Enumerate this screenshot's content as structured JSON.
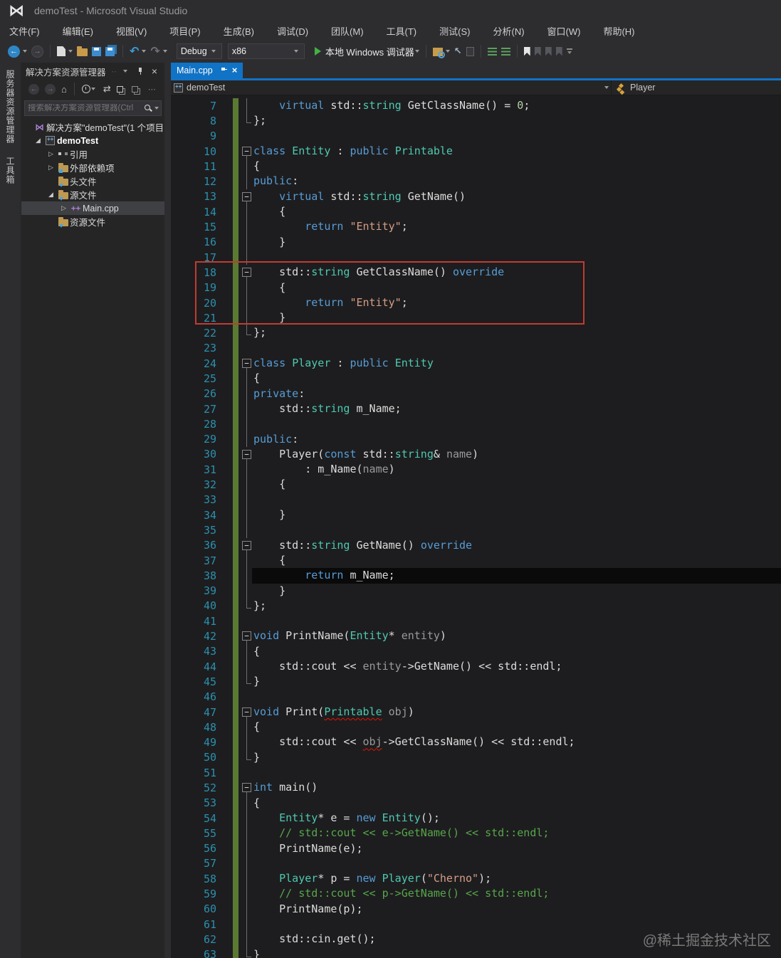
{
  "title_bar": {
    "app_title": "demoTest - Microsoft Visual Studio"
  },
  "menu_bar": {
    "items": [
      "文件(F)",
      "编辑(E)",
      "视图(V)",
      "项目(P)",
      "生成(B)",
      "调试(D)",
      "团队(M)",
      "工具(T)",
      "测试(S)",
      "分析(N)",
      "窗口(W)",
      "帮助(H)"
    ]
  },
  "toolbar": {
    "left_icons": [
      "navigate-back",
      "navigate-forward",
      "separator",
      "new-file",
      "open-file",
      "save",
      "save-all",
      "separator",
      "undo",
      "redo"
    ],
    "configuration": "Debug",
    "platform": "x86",
    "start_label": "本地 Windows 调试器",
    "right_icons": [
      "separator",
      "find-in-files",
      "navigate-to",
      "paste",
      "separator",
      "comment-selection",
      "uncomment-selection",
      "separator",
      "toggle-bookmark",
      "previous-bookmark",
      "next-bookmark",
      "clear-bookmarks",
      "overflow"
    ]
  },
  "side_strip": {
    "tabs": [
      "服务器资源管理器",
      "工具箱"
    ]
  },
  "solution_explorer": {
    "title": "解决方案资源管理器",
    "toolbar_icons": [
      "back",
      "forward",
      "home",
      "separator",
      "changes-filter",
      "sync-active-document",
      "collapse-all",
      "properties",
      "overflow-dots"
    ],
    "search_placeholder": "搜索解决方案资源管理器(Ctrl",
    "tree": [
      {
        "id": "solution",
        "label": "解决方案\"demoTest\"(1 个项目",
        "icon": "solution",
        "twisty": "",
        "depth": 0,
        "bold": false,
        "selected": false
      },
      {
        "id": "project-demotest",
        "label": "demoTest",
        "icon": "vcxproj",
        "twisty": "expanded",
        "depth": 1,
        "bold": true,
        "selected": false
      },
      {
        "id": "references",
        "label": "引用",
        "icon": "references",
        "twisty": "collapsed",
        "depth": 2,
        "bold": false,
        "selected": false
      },
      {
        "id": "external-dependencies",
        "label": "外部依赖项",
        "icon": "dep-folder",
        "twisty": "collapsed",
        "depth": 2,
        "bold": false,
        "selected": false
      },
      {
        "id": "header-files",
        "label": "头文件",
        "icon": "filter-folder",
        "twisty": "",
        "depth": 2,
        "bold": false,
        "selected": false
      },
      {
        "id": "source-files",
        "label": "源文件",
        "icon": "filter-folder",
        "twisty": "expanded",
        "depth": 2,
        "bold": false,
        "selected": false
      },
      {
        "id": "main-cpp",
        "label": "Main.cpp",
        "icon": "cpp-file",
        "twisty": "collapsed",
        "depth": 3,
        "bold": false,
        "selected": true
      },
      {
        "id": "resource-files",
        "label": "资源文件",
        "icon": "filter-folder",
        "twisty": "",
        "depth": 2,
        "bold": false,
        "selected": false
      }
    ]
  },
  "editor": {
    "tab_label": "Main.cpp",
    "breadcrumb": {
      "project": "demoTest",
      "member": "Player"
    },
    "code": {
      "current_line": 38,
      "lines": [
        {
          "n": 7,
          "g": "line",
          "tk": [
            [
              "    ",
              "pl"
            ],
            [
              "virtual",
              "kw"
            ],
            [
              " std::",
              "pl"
            ],
            [
              "string",
              "ty"
            ],
            [
              " GetClassName() = ",
              "pl"
            ],
            [
              "0",
              "nm"
            ],
            [
              ";",
              "pl"
            ]
          ]
        },
        {
          "n": 8,
          "g": "end",
          "tk": [
            [
              "};",
              "pl"
            ]
          ]
        },
        {
          "n": 9,
          "g": "",
          "tk": []
        },
        {
          "n": 10,
          "g": "box",
          "tk": [
            [
              "class",
              "kw"
            ],
            [
              " ",
              "pl"
            ],
            [
              "Entity",
              "ty"
            ],
            [
              " : ",
              "pl"
            ],
            [
              "public",
              "kw"
            ],
            [
              " ",
              "pl"
            ],
            [
              "Printable",
              "ty"
            ]
          ]
        },
        {
          "n": 11,
          "g": "line",
          "tk": [
            [
              "{",
              "pl"
            ]
          ]
        },
        {
          "n": 12,
          "g": "line",
          "tk": [
            [
              "public",
              "kw"
            ],
            [
              ":",
              "pl"
            ]
          ]
        },
        {
          "n": 13,
          "g": "box",
          "tk": [
            [
              "    ",
              "pl"
            ],
            [
              "virtual",
              "kw"
            ],
            [
              " std::",
              "pl"
            ],
            [
              "string",
              "ty"
            ],
            [
              " GetName()",
              "pl"
            ]
          ]
        },
        {
          "n": 14,
          "g": "line",
          "tk": [
            [
              "    {",
              "pl"
            ]
          ]
        },
        {
          "n": 15,
          "g": "line",
          "tk": [
            [
              "        ",
              "pl"
            ],
            [
              "return",
              "kw"
            ],
            [
              " ",
              "pl"
            ],
            [
              "\"Entity\"",
              "st"
            ],
            [
              ";",
              "pl"
            ]
          ]
        },
        {
          "n": 16,
          "g": "line",
          "tk": [
            [
              "    }",
              "pl"
            ]
          ]
        },
        {
          "n": 17,
          "g": "line",
          "tk": []
        },
        {
          "n": 18,
          "g": "box",
          "tk": [
            [
              "    std::",
              "pl"
            ],
            [
              "string",
              "ty"
            ],
            [
              " GetClassName() ",
              "pl"
            ],
            [
              "override",
              "kw"
            ]
          ]
        },
        {
          "n": 19,
          "g": "line",
          "tk": [
            [
              "    {",
              "pl"
            ]
          ]
        },
        {
          "n": 20,
          "g": "line",
          "tk": [
            [
              "        ",
              "pl"
            ],
            [
              "return",
              "kw"
            ],
            [
              " ",
              "pl"
            ],
            [
              "\"Entity\"",
              "st"
            ],
            [
              ";",
              "pl"
            ]
          ]
        },
        {
          "n": 21,
          "g": "line",
          "tk": [
            [
              "    }",
              "pl"
            ]
          ]
        },
        {
          "n": 22,
          "g": "end",
          "tk": [
            [
              "};",
              "pl"
            ]
          ]
        },
        {
          "n": 23,
          "g": "",
          "tk": []
        },
        {
          "n": 24,
          "g": "box",
          "tk": [
            [
              "class",
              "kw"
            ],
            [
              " ",
              "pl"
            ],
            [
              "Player",
              "ty"
            ],
            [
              " : ",
              "pl"
            ],
            [
              "public",
              "kw"
            ],
            [
              " ",
              "pl"
            ],
            [
              "Entity",
              "ty"
            ]
          ]
        },
        {
          "n": 25,
          "g": "line",
          "tk": [
            [
              "{",
              "pl"
            ]
          ]
        },
        {
          "n": 26,
          "g": "line",
          "tk": [
            [
              "private",
              "kw"
            ],
            [
              ":",
              "pl"
            ]
          ]
        },
        {
          "n": 27,
          "g": "line",
          "tk": [
            [
              "    std::",
              "pl"
            ],
            [
              "string",
              "ty"
            ],
            [
              " m_Name;",
              "pl"
            ]
          ]
        },
        {
          "n": 28,
          "g": "line",
          "tk": []
        },
        {
          "n": 29,
          "g": "line",
          "tk": [
            [
              "public",
              "kw"
            ],
            [
              ":",
              "pl"
            ]
          ]
        },
        {
          "n": 30,
          "g": "box",
          "tk": [
            [
              "    Player(",
              "pl"
            ],
            [
              "const",
              "kw"
            ],
            [
              " std::",
              "pl"
            ],
            [
              "string",
              "ty"
            ],
            [
              "& ",
              "pl"
            ],
            [
              "name",
              "pr"
            ],
            [
              ")",
              "pl"
            ]
          ]
        },
        {
          "n": 31,
          "g": "line",
          "tk": [
            [
              "        : m_Name(",
              "pl"
            ],
            [
              "name",
              "pr"
            ],
            [
              ")",
              "pl"
            ]
          ]
        },
        {
          "n": 32,
          "g": "line",
          "tk": [
            [
              "    {",
              "pl"
            ]
          ]
        },
        {
          "n": 33,
          "g": "line",
          "tk": []
        },
        {
          "n": 34,
          "g": "line",
          "tk": [
            [
              "    }",
              "pl"
            ]
          ]
        },
        {
          "n": 35,
          "g": "line",
          "tk": []
        },
        {
          "n": 36,
          "g": "box",
          "tk": [
            [
              "    std::",
              "pl"
            ],
            [
              "string",
              "ty"
            ],
            [
              " GetName() ",
              "pl"
            ],
            [
              "override",
              "kw"
            ]
          ]
        },
        {
          "n": 37,
          "g": "line",
          "tk": [
            [
              "    {",
              "pl"
            ]
          ]
        },
        {
          "n": 38,
          "g": "line",
          "hl": true,
          "tk": [
            [
              "        ",
              "pl"
            ],
            [
              "return",
              "kw"
            ],
            [
              " m_Name;",
              "pl"
            ]
          ]
        },
        {
          "n": 39,
          "g": "line",
          "tk": [
            [
              "    }",
              "pl"
            ]
          ]
        },
        {
          "n": 40,
          "g": "end",
          "tk": [
            [
              "};",
              "pl"
            ]
          ]
        },
        {
          "n": 41,
          "g": "",
          "tk": []
        },
        {
          "n": 42,
          "g": "box",
          "tk": [
            [
              "void",
              "kw"
            ],
            [
              " PrintName(",
              "pl"
            ],
            [
              "Entity",
              "ty"
            ],
            [
              "* ",
              "pl"
            ],
            [
              "entity",
              "pr"
            ],
            [
              ")",
              "pl"
            ]
          ]
        },
        {
          "n": 43,
          "g": "line",
          "tk": [
            [
              "{",
              "pl"
            ]
          ]
        },
        {
          "n": 44,
          "g": "line",
          "tk": [
            [
              "    std::cout << ",
              "pl"
            ],
            [
              "entity",
              "pr"
            ],
            [
              "->GetName() << std::endl;",
              "pl"
            ]
          ]
        },
        {
          "n": 45,
          "g": "end",
          "tk": [
            [
              "}",
              "pl"
            ]
          ]
        },
        {
          "n": 46,
          "g": "",
          "tk": []
        },
        {
          "n": 47,
          "g": "box",
          "tk": [
            [
              "void",
              "kw"
            ],
            [
              " Print(",
              "pl"
            ],
            [
              "Printable",
              "ty",
              "sq"
            ],
            [
              " ",
              "pl"
            ],
            [
              "obj",
              "pr"
            ],
            [
              ")",
              "pl"
            ]
          ]
        },
        {
          "n": 48,
          "g": "line",
          "tk": [
            [
              "{",
              "pl"
            ]
          ]
        },
        {
          "n": 49,
          "g": "line",
          "tk": [
            [
              "    std::cout << ",
              "pl"
            ],
            [
              "obj",
              "pr",
              "sq"
            ],
            [
              "->GetClassName() << std::endl;",
              "pl"
            ]
          ]
        },
        {
          "n": 50,
          "g": "end",
          "tk": [
            [
              "}",
              "pl"
            ]
          ]
        },
        {
          "n": 51,
          "g": "",
          "tk": []
        },
        {
          "n": 52,
          "g": "box",
          "tk": [
            [
              "int",
              "kw"
            ],
            [
              " main()",
              "pl"
            ]
          ]
        },
        {
          "n": 53,
          "g": "line",
          "tk": [
            [
              "{",
              "pl"
            ]
          ]
        },
        {
          "n": 54,
          "g": "line",
          "tk": [
            [
              "    ",
              "pl"
            ],
            [
              "Entity",
              "ty"
            ],
            [
              "* e = ",
              "pl"
            ],
            [
              "new",
              "kw"
            ],
            [
              " ",
              "pl"
            ],
            [
              "Entity",
              "ty"
            ],
            [
              "();",
              "pl"
            ]
          ]
        },
        {
          "n": 55,
          "g": "line",
          "tk": [
            [
              "    ",
              "pl"
            ],
            [
              "// std::cout << e->GetName() << std::endl;",
              "cm"
            ]
          ]
        },
        {
          "n": 56,
          "g": "line",
          "tk": [
            [
              "    PrintName(e);",
              "pl"
            ]
          ]
        },
        {
          "n": 57,
          "g": "line",
          "tk": []
        },
        {
          "n": 58,
          "g": "line",
          "tk": [
            [
              "    ",
              "pl"
            ],
            [
              "Player",
              "ty"
            ],
            [
              "* p = ",
              "pl"
            ],
            [
              "new",
              "kw"
            ],
            [
              " ",
              "pl"
            ],
            [
              "Player",
              "ty"
            ],
            [
              "(",
              "pl"
            ],
            [
              "\"Cherno\"",
              "st"
            ],
            [
              ");",
              "pl"
            ]
          ]
        },
        {
          "n": 59,
          "g": "line",
          "tk": [
            [
              "    ",
              "pl"
            ],
            [
              "// std::cout << p->GetName() << std::endl;",
              "cm"
            ]
          ]
        },
        {
          "n": 60,
          "g": "line",
          "tk": [
            [
              "    PrintName(p);",
              "pl"
            ]
          ]
        },
        {
          "n": 61,
          "g": "line",
          "tk": []
        },
        {
          "n": 62,
          "g": "line",
          "tk": [
            [
              "    std::cin.get();",
              "pl"
            ]
          ]
        },
        {
          "n": 63,
          "g": "end",
          "tk": [
            [
              "}",
              "pl"
            ]
          ]
        }
      ]
    }
  },
  "annotation": {
    "shape": "rectangle",
    "color": "#C23B31",
    "lines_covered": "18-21"
  },
  "watermark": "@稀土掘金技术社区",
  "colors": {
    "accent_blue": "#1173C5",
    "keyword": "#569CD6",
    "type": "#4EC9B0",
    "string": "#D69D85",
    "comment": "#57A64A",
    "parameter": "#9A9A9A",
    "number": "#B5CEA8",
    "line_number": "#2B91AF",
    "change_tracking_green": "#5A7A32",
    "annotation_red": "#C23B31",
    "current_line_bg": "#0A0A0A",
    "editor_bg": "#1D1D1F",
    "chrome_bg": "#2D2D30",
    "panel_bg": "#252526"
  }
}
